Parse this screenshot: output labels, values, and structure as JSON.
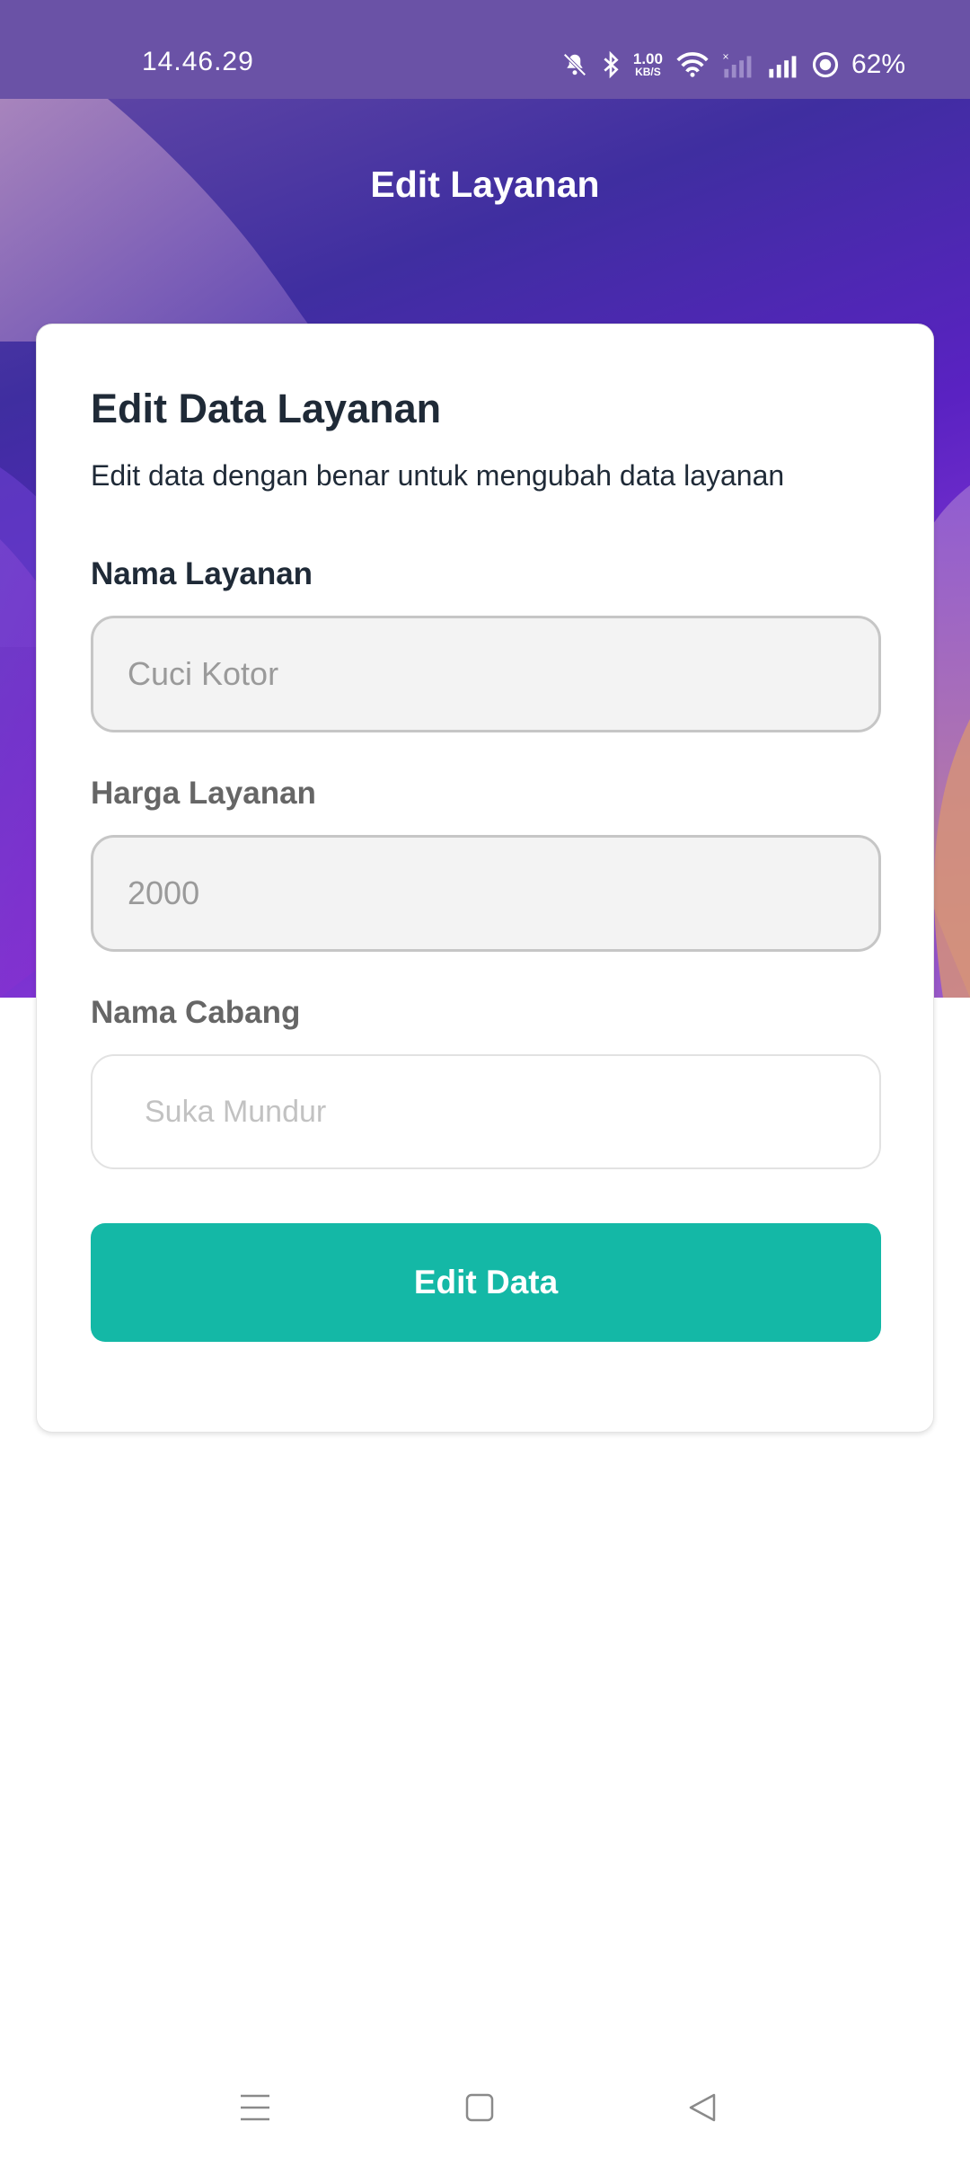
{
  "status_bar": {
    "time": "14.46.29",
    "net_speed_value": "1.00",
    "net_speed_unit": "KB/S",
    "battery": "62%",
    "icons": [
      "mute-bell-icon",
      "bluetooth-icon",
      "wifi-icon",
      "signal-sim1-icon",
      "signal-sim2-icon",
      "battery-saver-icon"
    ]
  },
  "header": {
    "title": "Edit Layanan"
  },
  "form": {
    "title": "Edit Data Layanan",
    "subtitle": "Edit data dengan benar untuk mengubah data layanan",
    "fields": [
      {
        "label": "Nama Layanan",
        "value": "Cuci Kotor"
      },
      {
        "label": "Harga Layanan",
        "value": "2000"
      },
      {
        "label": "Nama Cabang",
        "placeholder": "Suka Mundur"
      }
    ],
    "submit_label": "Edit Data"
  },
  "colors": {
    "accent": "#14b8a6",
    "hero_start": "#6b4fa7",
    "hero_end": "#7f34d2",
    "text_dark": "#1f2a37"
  },
  "nav": {
    "icons": [
      "menu-icon",
      "home-square-icon",
      "back-triangle-icon"
    ]
  }
}
